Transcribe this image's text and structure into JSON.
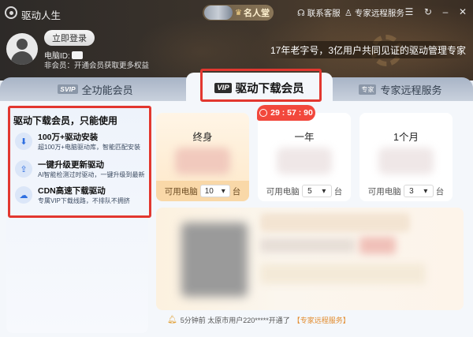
{
  "window": {
    "title": "驱动人生",
    "fame_hall": "名人堂",
    "support": "联系客服",
    "expert_service": "专家远程服务"
  },
  "user": {
    "login_button": "立即登录",
    "pc_id_label": "电脑ID:",
    "status_text": "非会员：开通会员获取更多权益"
  },
  "banner": {
    "tagline": "17年老字号，3亿用户共同见证的驱动管理专家"
  },
  "tabs": [
    {
      "badge": "SVIP",
      "label": "全功能会员",
      "active": false
    },
    {
      "badge": "VIP",
      "label": "驱动下载会员",
      "active": true
    },
    {
      "badge": "专家",
      "label": "专家远程服务",
      "active": false
    }
  ],
  "features": {
    "title": "驱动下载会员，只能使用",
    "items": [
      {
        "name": "100万+驱动安装",
        "desc": "超100万+电脑驱动库，智能匹配安装",
        "icon": "download-icon"
      },
      {
        "name": "一键升级更新驱动",
        "desc": "AI智能检测过时驱动，一键升级到最新",
        "icon": "upgrade-icon"
      },
      {
        "name": "CDN高速下载驱动",
        "desc": "专属VIP下载线路，不排队不拥挤",
        "icon": "cdn-icon"
      }
    ]
  },
  "timer": "29 : 57 : 90",
  "plans": [
    {
      "name": "终身",
      "devices_label": "可用电脑",
      "devices": "10",
      "unit": "台",
      "selected": true
    },
    {
      "name": "一年",
      "devices_label": "可用电脑",
      "devices": "5",
      "unit": "台",
      "selected": false
    },
    {
      "name": "1个月",
      "devices_label": "可用电脑",
      "devices": "3",
      "unit": "台",
      "selected": false
    }
  ],
  "notice": {
    "prefix": "5分钟前 太原市用户220*****开通了",
    "highlight": "【专家远程服务】"
  },
  "colors": {
    "highlight_frame": "#e2372f",
    "timer_bg": "#f2483c",
    "accent_blue": "#2f6fe0",
    "selected_card": "#fde8c9"
  }
}
